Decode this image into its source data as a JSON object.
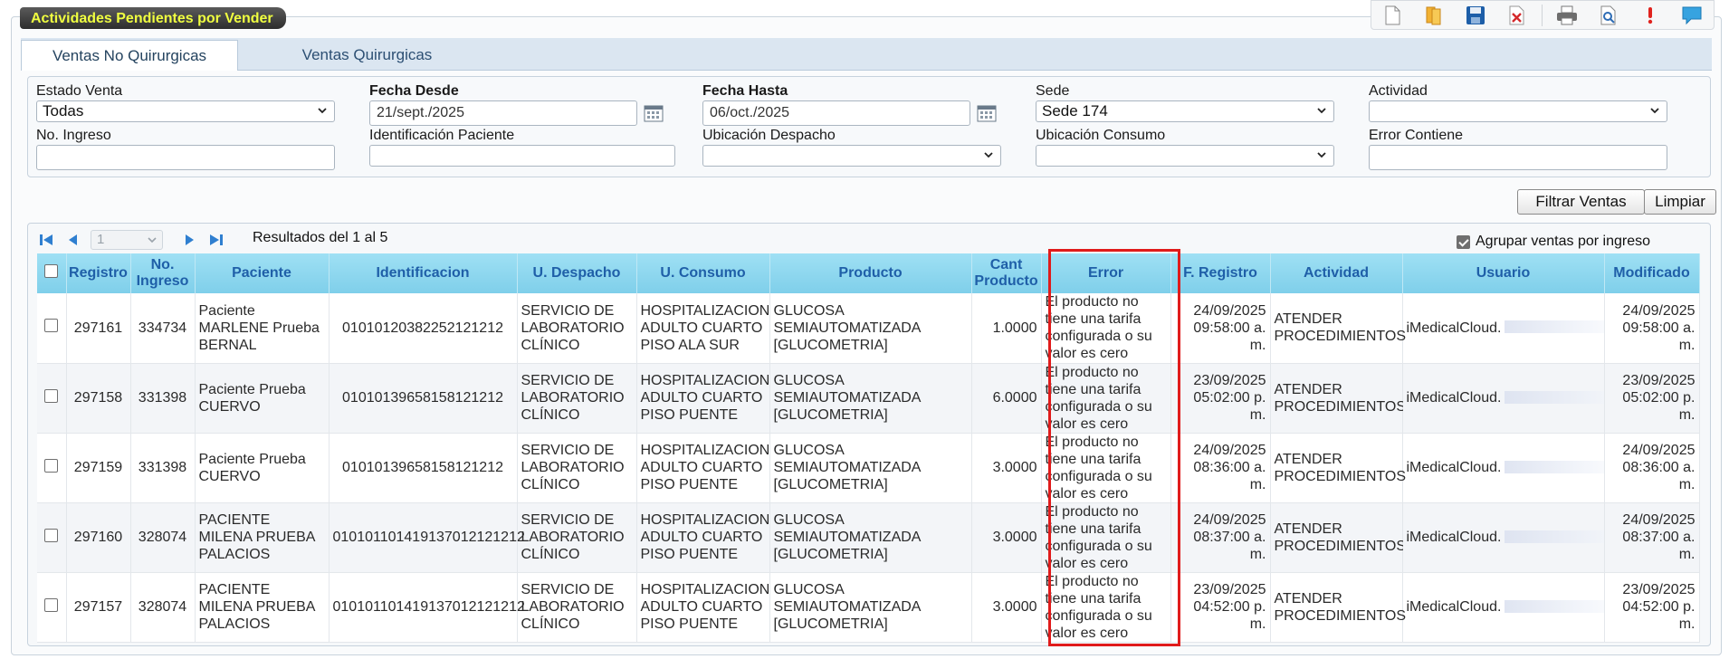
{
  "window": {
    "title": "Actividades Pendientes por Vender"
  },
  "tabs": [
    {
      "label": "Ventas No Quirurgicas",
      "active": true
    },
    {
      "label": "Ventas Quirurgicas",
      "active": false
    }
  ],
  "toolbar": {
    "icons": [
      "new-document-icon",
      "open-folder-icon",
      "save-icon",
      "delete-document-icon",
      "print-icon",
      "print-preview-icon",
      "alert-icon",
      "chat-icon"
    ]
  },
  "filters": {
    "estado_venta": {
      "label": "Estado Venta",
      "value": "Todas"
    },
    "fecha_desde": {
      "label": "Fecha Desde",
      "value": "21/sept./2025"
    },
    "fecha_hasta": {
      "label": "Fecha Hasta",
      "value": "06/oct./2025"
    },
    "sede": {
      "label": "Sede",
      "value": "Sede 174"
    },
    "actividad": {
      "label": "Actividad",
      "value": ""
    },
    "no_ingreso": {
      "label": "No. Ingreso",
      "value": ""
    },
    "identificacion_paciente": {
      "label": "Identificación Paciente",
      "value": ""
    },
    "ubicacion_despacho": {
      "label": "Ubicación Despacho",
      "value": ""
    },
    "ubicacion_consumo": {
      "label": "Ubicación Consumo",
      "value": ""
    },
    "error_contiene": {
      "label": "Error Contiene",
      "value": ""
    }
  },
  "actions": {
    "filter_label": "Filtrar Ventas",
    "clear_label": "Limpiar"
  },
  "pager": {
    "page": "1",
    "results_text": "Resultados del 1 al 5"
  },
  "group_by_ingreso": {
    "label": "Agrupar ventas por ingreso",
    "checked": true
  },
  "grid": {
    "columns": [
      "Registro",
      "No. Ingreso",
      "Paciente",
      "Identificacion",
      "U. Despacho",
      "U. Consumo",
      "Producto",
      "Cant Producto",
      "Error",
      "F. Registro",
      "Actividad",
      "Usuario",
      "Modificado"
    ],
    "rows": [
      {
        "registro": "297161",
        "ingreso": "334734",
        "paciente": "Paciente MARLENE Prueba BERNAL",
        "identificacion": "01010120382252121212",
        "despacho": "SERVICIO DE LABORATORIO CLÍNICO",
        "consumo": "HOSPITALIZACION ADULTO CUARTO PISO ALA SUR",
        "producto": "GLUCOSA SEMIAUTOMATIZADA [GLUCOMETRIA]",
        "cantidad": "1.0000",
        "error": "El producto no tiene una tarifa configurada o su valor es cero",
        "f_registro": "24/09/2025 09:58:00 a. m.",
        "actividad": "ATENDER PROCEDIMIENTOS",
        "usuario": "iMedicalCloud.",
        "modificado": "24/09/2025 09:58:00 a. m."
      },
      {
        "registro": "297158",
        "ingreso": "331398",
        "paciente": "Paciente Prueba CUERVO",
        "identificacion": "01010139658158121212",
        "despacho": "SERVICIO DE LABORATORIO CLÍNICO",
        "consumo": "HOSPITALIZACION ADULTO CUARTO PISO PUENTE",
        "producto": "GLUCOSA SEMIAUTOMATIZADA [GLUCOMETRIA]",
        "cantidad": "6.0000",
        "error": "El producto no tiene una tarifa configurada o su valor es cero",
        "f_registro": "23/09/2025 05:02:00 p. m.",
        "actividad": "ATENDER PROCEDIMIENTOS",
        "usuario": "iMedicalCloud.",
        "modificado": "23/09/2025 05:02:00 p. m."
      },
      {
        "registro": "297159",
        "ingreso": "331398",
        "paciente": "Paciente Prueba CUERVO",
        "identificacion": "01010139658158121212",
        "despacho": "SERVICIO DE LABORATORIO CLÍNICO",
        "consumo": "HOSPITALIZACION ADULTO CUARTO PISO PUENTE",
        "producto": "GLUCOSA SEMIAUTOMATIZADA [GLUCOMETRIA]",
        "cantidad": "3.0000",
        "error": "El producto no tiene una tarifa configurada o su valor es cero",
        "f_registro": "24/09/2025 08:36:00 a. m.",
        "actividad": "ATENDER PROCEDIMIENTOS",
        "usuario": "iMedicalCloud.",
        "modificado": "24/09/2025 08:36:00 a. m."
      },
      {
        "registro": "297160",
        "ingreso": "328074",
        "paciente": "PACIENTE MILENA PRUEBA PALACIOS",
        "identificacion": "010101101419137012121212",
        "despacho": "SERVICIO DE LABORATORIO CLÍNICO",
        "consumo": "HOSPITALIZACION ADULTO CUARTO PISO PUENTE",
        "producto": "GLUCOSA SEMIAUTOMATIZADA [GLUCOMETRIA]",
        "cantidad": "3.0000",
        "error": "El producto no tiene una tarifa configurada o su valor es cero",
        "f_registro": "24/09/2025 08:37:00 a. m.",
        "actividad": "ATENDER PROCEDIMIENTOS",
        "usuario": "iMedicalCloud.",
        "modificado": "24/09/2025 08:37:00 a. m."
      },
      {
        "registro": "297157",
        "ingreso": "328074",
        "paciente": "PACIENTE MILENA PRUEBA PALACIOS",
        "identificacion": "010101101419137012121212",
        "despacho": "SERVICIO DE LABORATORIO CLÍNICO",
        "consumo": "HOSPITALIZACION ADULTO CUARTO PISO PUENTE",
        "producto": "GLUCOSA SEMIAUTOMATIZADA [GLUCOMETRIA]",
        "cantidad": "3.0000",
        "error": "El producto no tiene una tarifa configurada o su valor es cero",
        "f_registro": "23/09/2025 04:52:00 p. m.",
        "actividad": "ATENDER PROCEDIMIENTOS",
        "usuario": "iMedicalCloud.",
        "modificado": "23/09/2025 04:52:00 p. m."
      }
    ]
  },
  "colors": {
    "header_gradient_top": "#9fe0f4",
    "header_text": "#1f5fa8",
    "title_text": "#f0ff40",
    "highlight_border": "#e01b1b"
  }
}
